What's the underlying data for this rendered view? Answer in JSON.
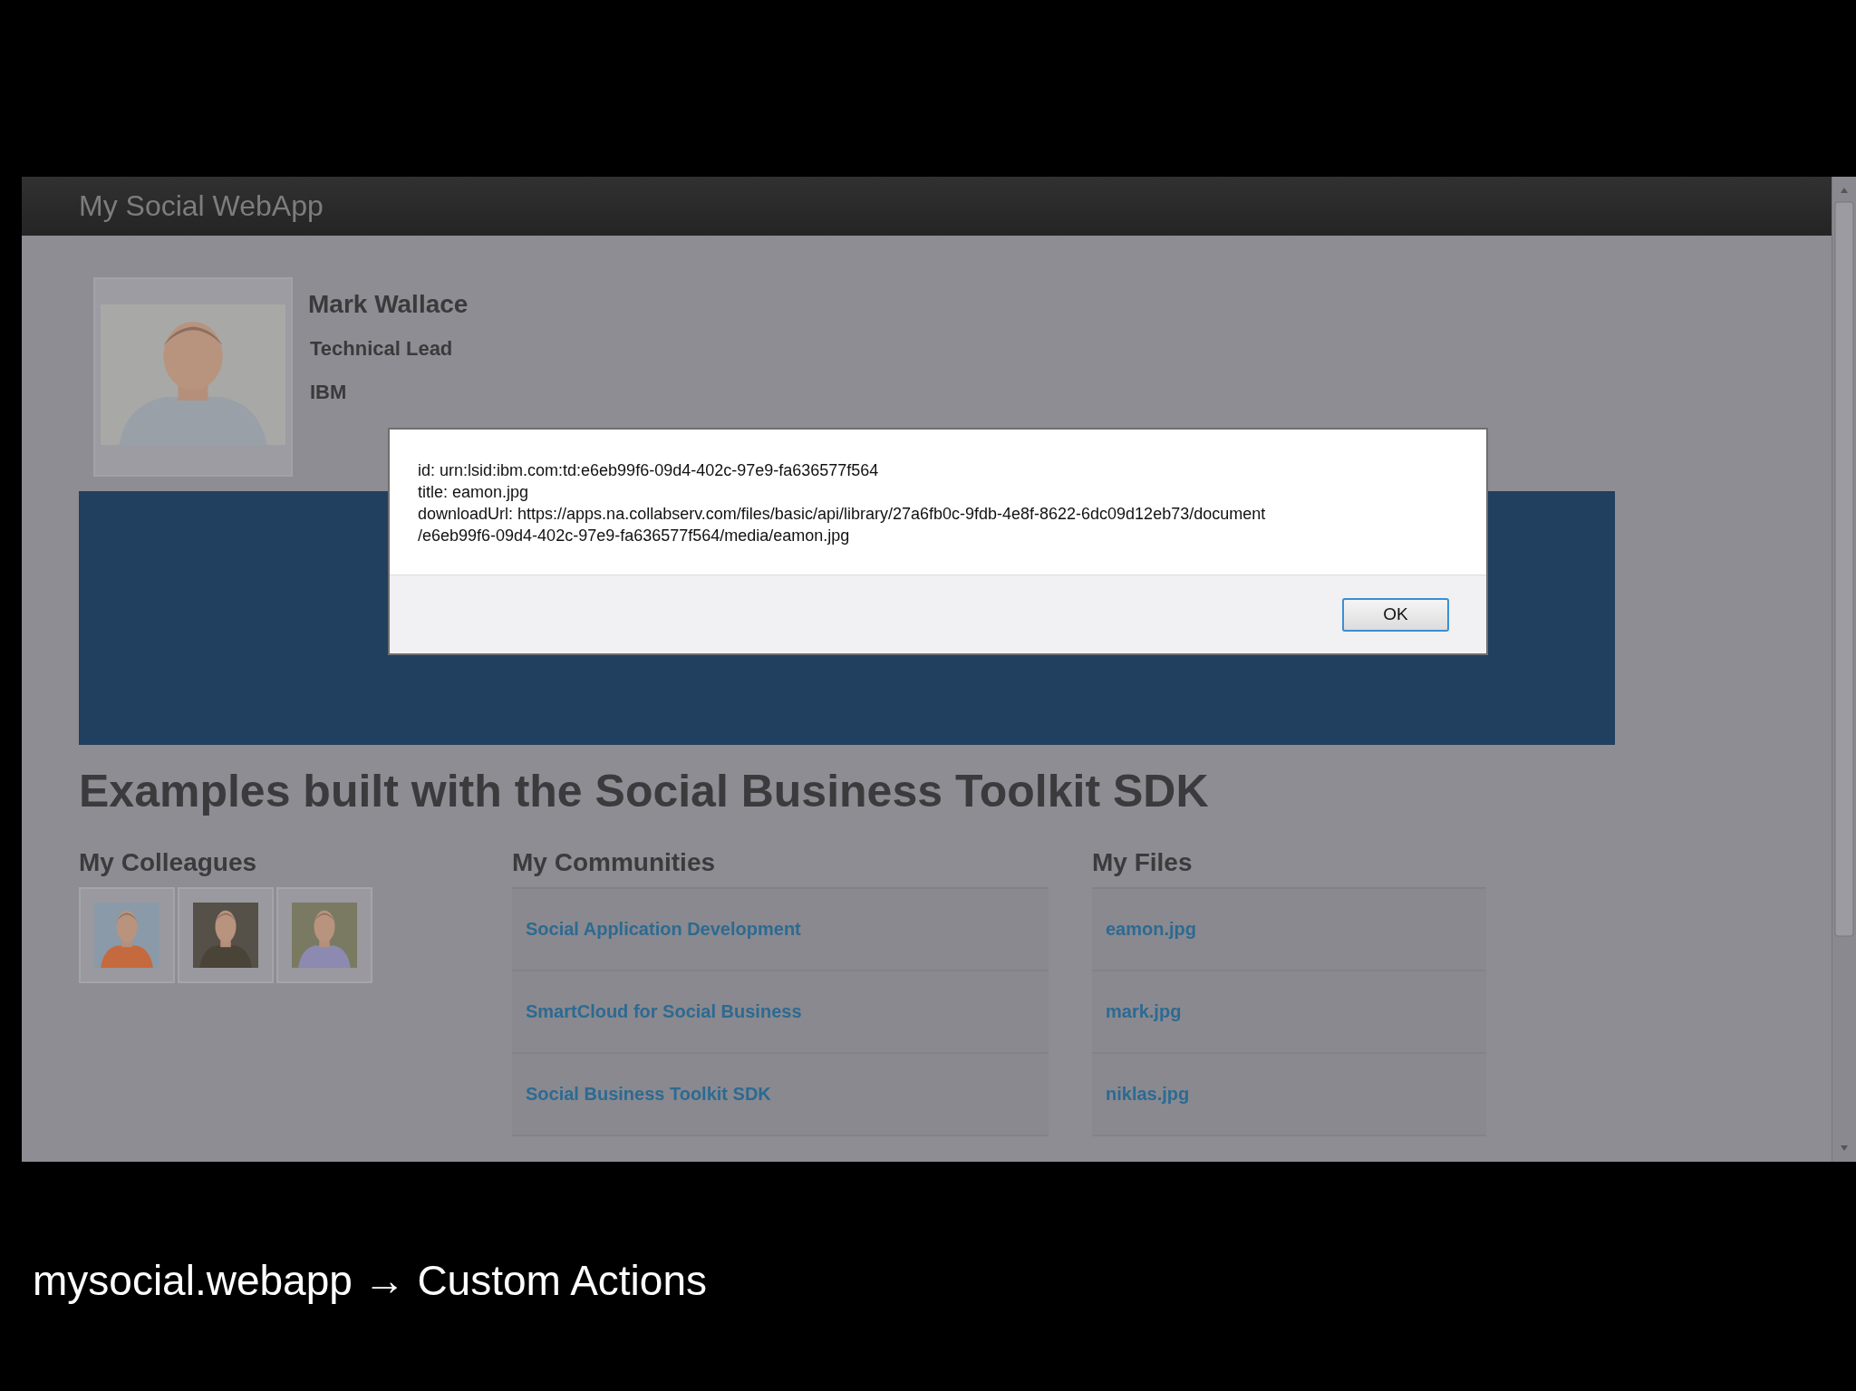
{
  "app": {
    "title": "My Social WebApp"
  },
  "profile": {
    "name": "Mark Wallace",
    "job_title": "Technical Lead",
    "organization": "IBM"
  },
  "heading": "Examples built with the Social Business Toolkit SDK",
  "colleagues": {
    "title": "My Colleagues"
  },
  "communities": {
    "title": "My Communities",
    "items": [
      "Social Application Development",
      "SmartCloud for Social Business",
      "Social Business Toolkit SDK"
    ]
  },
  "files": {
    "title": "My Files",
    "items": [
      "eamon.jpg",
      "mark.jpg",
      "niklas.jpg"
    ]
  },
  "dialog": {
    "lines": [
      "id: urn:lsid:ibm.com:td:e6eb99f6-09d4-402c-97e9-fa636577f564",
      "title: eamon.jpg",
      "downloadUrl: https://apps.na.collabserv.com/files/basic/api/library/27a6fb0c-9fdb-4e8f-8622-6dc09d12eb73/document",
      "/e6eb99f6-09d4-402c-97e9-fa636577f564/media/eamon.jpg"
    ],
    "button": "OK"
  },
  "caption": "mysocial.webapp → Custom Actions"
}
